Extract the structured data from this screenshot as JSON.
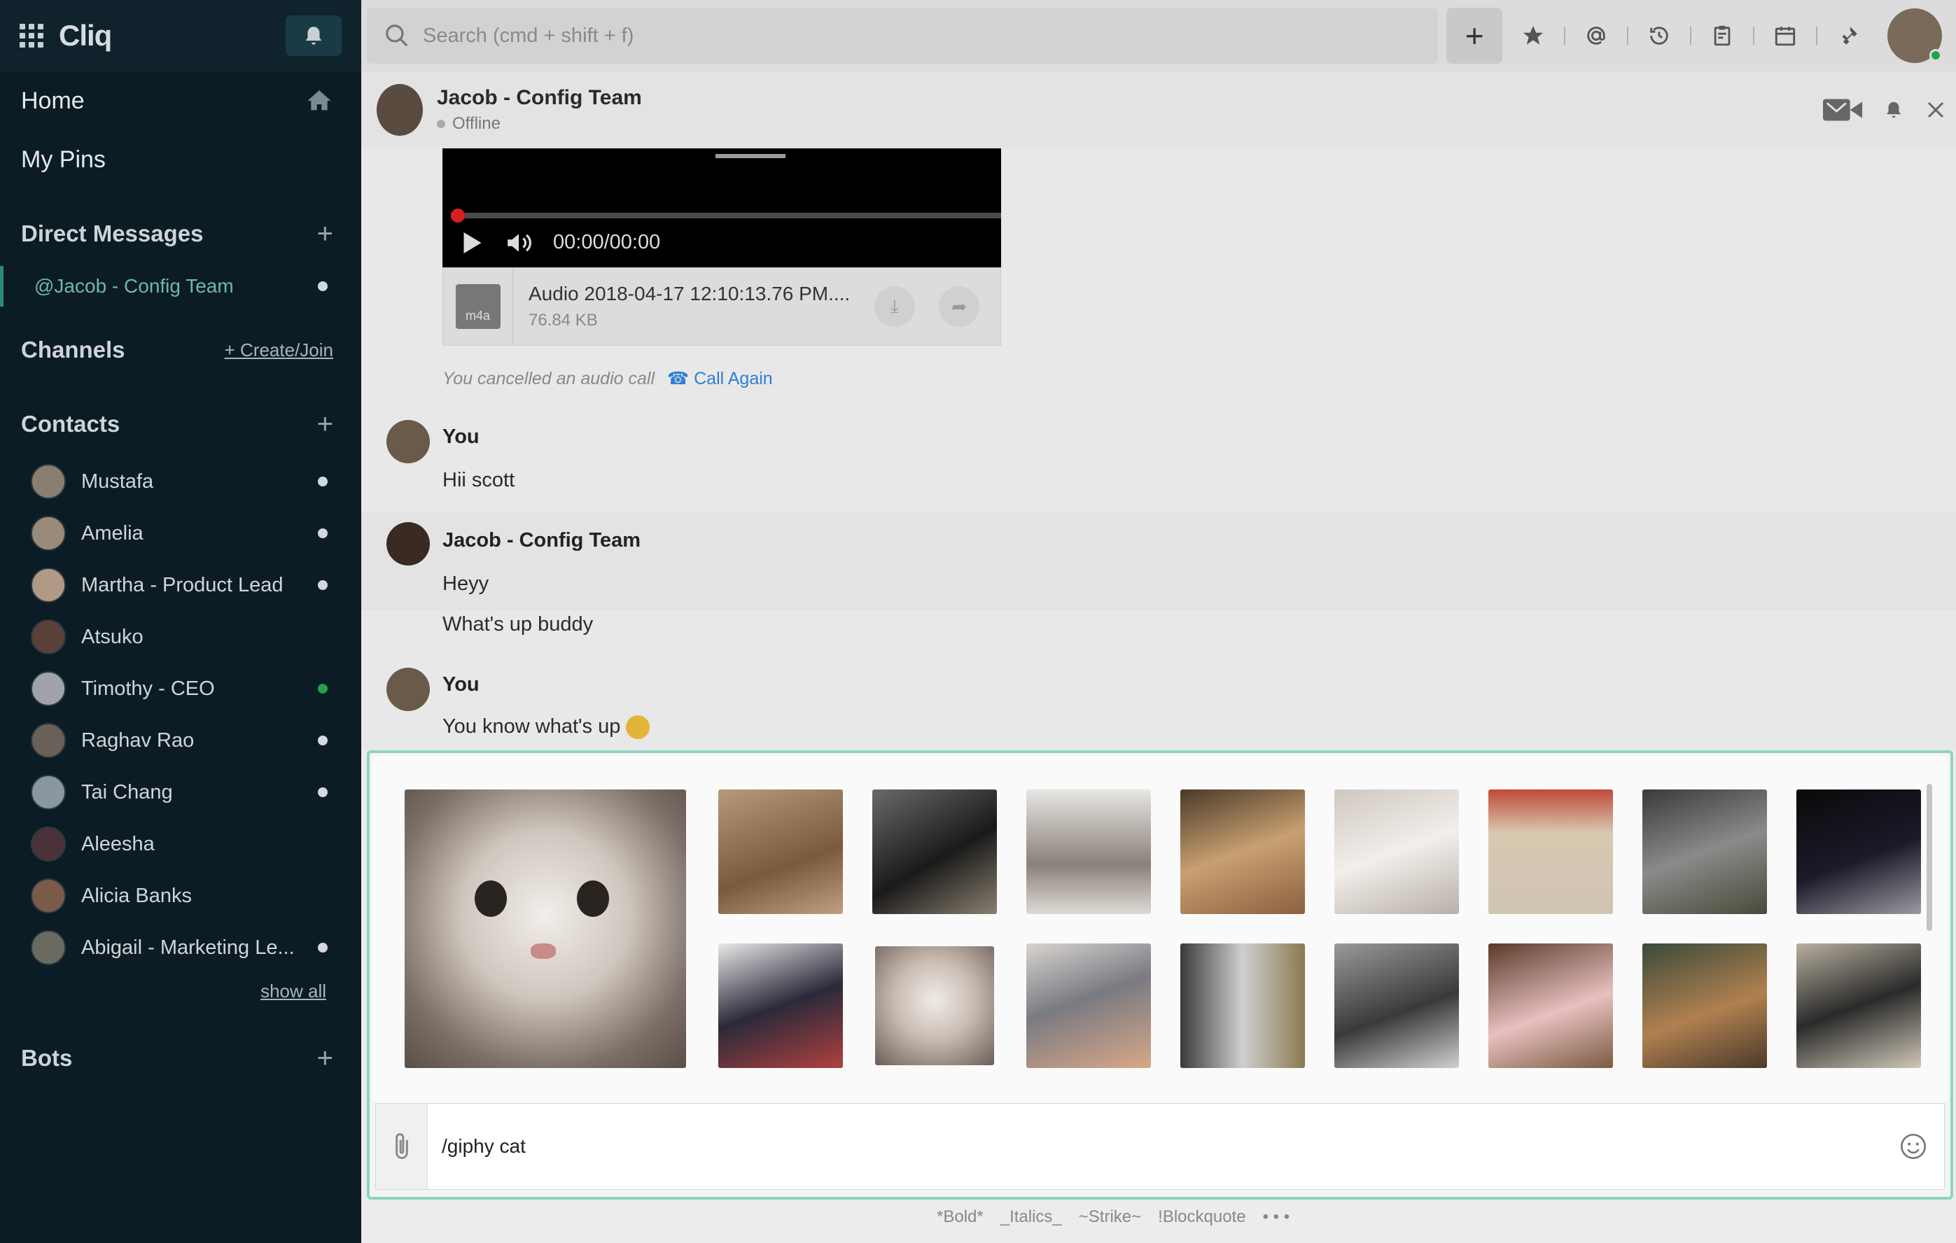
{
  "app": {
    "name": "Cliq"
  },
  "sidebar": {
    "home": "Home",
    "my_pins": "My Pins",
    "direct_messages": "Direct Messages",
    "dm_active": "@Jacob - Config Team",
    "channels": "Channels",
    "create_join": "+ Create/Join",
    "contacts_title": "Contacts",
    "contacts": [
      {
        "name": "Mustafa",
        "status": "away"
      },
      {
        "name": "Amelia",
        "status": "away"
      },
      {
        "name": "Martha - Product Lead",
        "status": "away"
      },
      {
        "name": "Atsuko",
        "status": "none"
      },
      {
        "name": "Timothy - CEO",
        "status": "online"
      },
      {
        "name": "Raghav Rao",
        "status": "away"
      },
      {
        "name": "Tai Chang",
        "status": "away"
      },
      {
        "name": "Aleesha",
        "status": "none"
      },
      {
        "name": "Alicia Banks",
        "status": "none"
      },
      {
        "name": "Abigail - Marketing Le...",
        "status": "away"
      }
    ],
    "show_all": "show all",
    "bots": "Bots"
  },
  "search": {
    "placeholder": "Search (cmd + shift + f)"
  },
  "topbar_icons": [
    "star-icon",
    "mention-icon",
    "history-icon",
    "clipboard-icon",
    "calendar-icon",
    "integration-icon"
  ],
  "chat": {
    "title": "Jacob - Config Team",
    "status": "Offline"
  },
  "messages": {
    "audio_time": "00:00/00:00",
    "file_name": "Audio 2018-04-17 12:10:13.76 PM....",
    "file_size": "76.84 KB",
    "file_ext": "m4a",
    "system": "You cancelled an audio call",
    "call_again": "Call Again",
    "m1_author": "You",
    "m1_text": "Hii scott",
    "m2_author": "Jacob - Config Team",
    "m2_text1": "Heyy",
    "m2_text2": "What's up buddy",
    "m3_author": "You",
    "m3_text": "You know what's up"
  },
  "composer": {
    "value": "/giphy cat"
  },
  "hints": {
    "bold": "*Bold*",
    "italics": "_Italics_",
    "strike": "~Strike~",
    "blockquote": "!Blockquote",
    "more": "• • •"
  },
  "colors": {
    "accent": "#2d8a7a",
    "online": "#22a24a",
    "composer_border": "#8fd3c2",
    "link": "#2f7fd1"
  }
}
